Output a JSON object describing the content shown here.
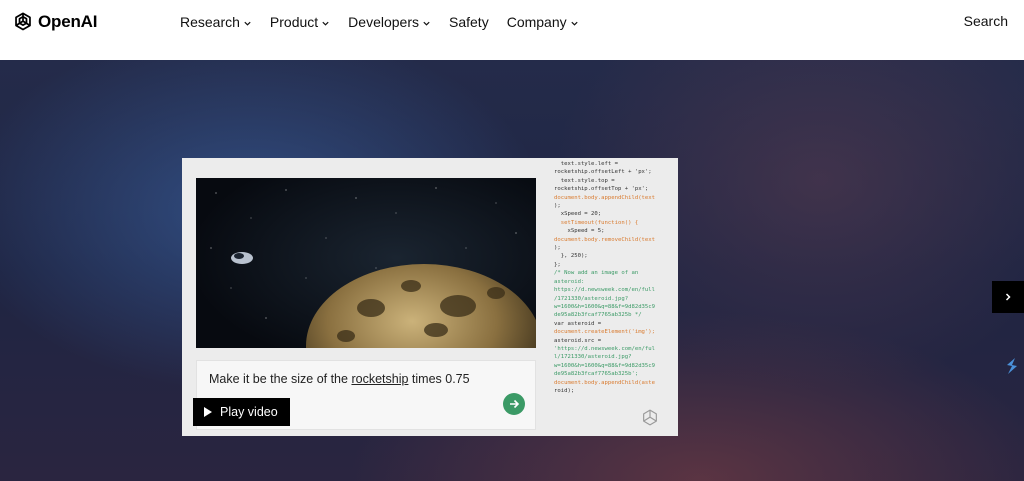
{
  "brand": {
    "name": "OpenAI",
    "icon": "openai-logo-icon"
  },
  "nav": {
    "items": [
      {
        "label": "Research",
        "has_dropdown": true
      },
      {
        "label": "Product",
        "has_dropdown": true
      },
      {
        "label": "Developers",
        "has_dropdown": true
      },
      {
        "label": "Safety",
        "has_dropdown": false
      },
      {
        "label": "Company",
        "has_dropdown": true
      }
    ],
    "search_label": "Search"
  },
  "demo": {
    "prompt_before": "Make it be the size of the ",
    "prompt_link": "rocketship",
    "prompt_after": " times 0.75",
    "play_label": "Play video",
    "code_lines": [
      "  text.style.left =",
      "rocketship.offsetLeft + 'px';",
      "  text.style.top =",
      "rocketship.offsetTop + 'px';",
      "",
      "document.body.appendChild(text",
      ");",
      "  xSpeed = 20;",
      "  setTimeout(function() {",
      "    xSpeed = 5;",
      "",
      "document.body.removeChild(text",
      ");",
      "  }, 250);",
      "};",
      "",
      "",
      "/* Now add an image of an",
      "asteroid:",
      "https://d.newsweek.com/en/full",
      "/1721330/asteroid.jpg?",
      "w=1600&h=1600&q=88&f=9d82d35c9",
      "de95a82b3fcaf7765ab325b */",
      "var asteroid =",
      "document.createElement('img');",
      "asteroid.src =",
      "'https://d.newsweek.com/en/ful",
      "l/1721330/asteroid.jpg?",
      "w=1600&h=1600&q=88&f=9d82d35c9",
      "de95a82b3fcaf7765ab325b';",
      "document.body.appendChild(aste",
      "roid);"
    ]
  },
  "colors": {
    "accent_green": "#3b9a66",
    "code_orange": "#d97a2e"
  },
  "icons": {
    "next": "chevron-right-icon",
    "send": "arrow-right-icon",
    "side": "stackshare-icon"
  }
}
